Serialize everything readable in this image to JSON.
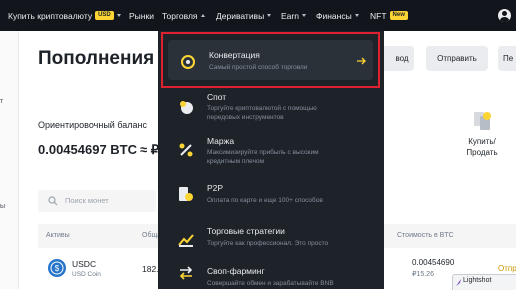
{
  "colors": {
    "accent": "#fcd535",
    "topbar_bg": "#12161c",
    "menu_bg": "#1e2329",
    "highlight_border": "#e0212f"
  },
  "nav": {
    "buy_crypto": "Купить криптовалюту",
    "currency_badge": "USD",
    "markets": "Рынки",
    "trade": "Торговля",
    "derivatives": "Деривативы",
    "earn": "Earn",
    "finance": "Финансы",
    "nft": "NFT",
    "new_badge": "New"
  },
  "page": {
    "title": "Пополнения"
  },
  "actions": {
    "withdraw_partial": "вод",
    "send": "Отправить",
    "transfer_partial": "Пе"
  },
  "balance": {
    "label": "Ориентировочный баланс",
    "value": "0.00454697 BTC",
    "approx": "≈ ₽"
  },
  "search": {
    "placeholder": "Поиск монет"
  },
  "table": {
    "headers": {
      "assets": "Активы",
      "total_partial": "Обща",
      "value_btc": "Стоимость в BTC"
    },
    "rows": [
      {
        "symbol": "USDC",
        "name": "USD Coin",
        "amount_partial": "182.",
        "btc_value": "0.00454690",
        "rub_value": "₽15.26",
        "action_partial": "Отпр"
      }
    ]
  },
  "sidebar": {
    "item1": "т",
    "item2": "ы"
  },
  "quick_action": {
    "label": "Купить/ Продать"
  },
  "menu": {
    "items": [
      {
        "title": "Конвертация",
        "desc": "Самый простой способ торговли",
        "icon": "convert-icon"
      },
      {
        "title": "Спот",
        "desc": "Торгуйте криптовалютой с помощью передовых инструментов",
        "icon": "spot-icon"
      },
      {
        "title": "Маржа",
        "desc": "Максимизируйте прибыль с высоким кредитным плечом",
        "icon": "margin-icon"
      },
      {
        "title": "P2P",
        "desc": "Оплата по карте и еще 100+ способов",
        "icon": "p2p-icon"
      },
      {
        "title": "Торговые стратегии",
        "desc": "Торгуйте как профессионал. Это просто",
        "icon": "strategy-icon"
      },
      {
        "title": "Своп-фарминг",
        "desc": "Совершайте обмен и зарабатывайте BNB",
        "icon": "swap-farming-icon"
      }
    ]
  },
  "lightshot": {
    "label": "Lightshot"
  }
}
